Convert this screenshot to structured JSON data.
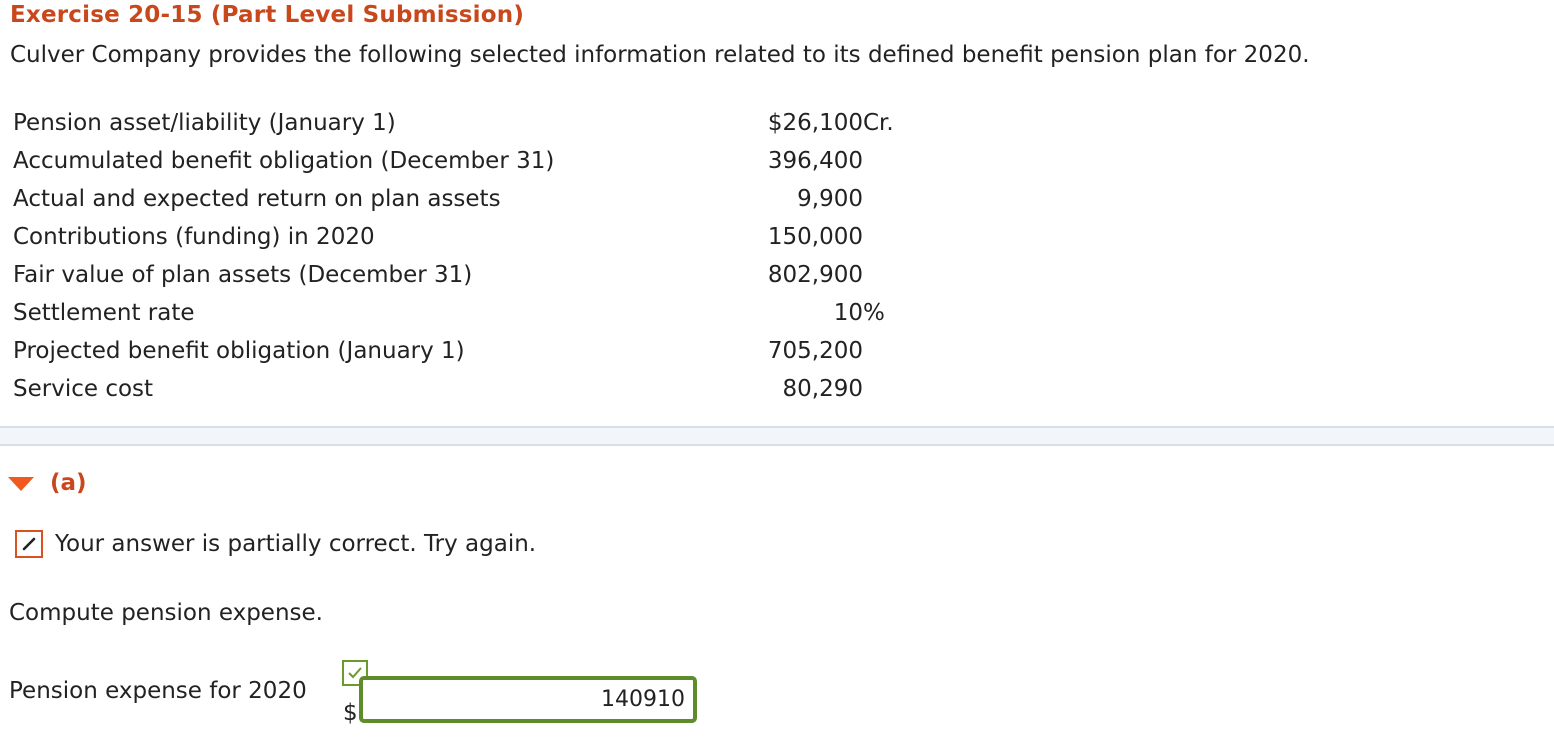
{
  "exercise": {
    "title": "Exercise 20-15 (Part Level Submission)",
    "intro": "Culver Company provides the following selected information related to its defined benefit pension plan for 2020."
  },
  "data_rows": [
    {
      "label": "Pension asset/liability (January 1)",
      "value": "$26,100",
      "suffix": " Cr."
    },
    {
      "label": "Accumulated benefit obligation (December 31)",
      "value": "396,400",
      "suffix": ""
    },
    {
      "label": "Actual and expected return on plan assets",
      "value": "9,900",
      "suffix": ""
    },
    {
      "label": "Contributions (funding) in 2020",
      "value": "150,000",
      "suffix": ""
    },
    {
      "label": "Fair value of plan assets (December 31)",
      "value": "802,900",
      "suffix": ""
    },
    {
      "label": "Settlement rate",
      "value": "10",
      "suffix": " %"
    },
    {
      "label": "Projected benefit obligation (January 1)",
      "value": "705,200",
      "suffix": ""
    },
    {
      "label": "Service cost",
      "value": "80,290",
      "suffix": ""
    }
  ],
  "part": {
    "label": "(a)",
    "toggle_icon": "caret-down-icon"
  },
  "feedback": {
    "icon": "pencil-icon",
    "text": "Your answer is partially correct.  Try again."
  },
  "question": {
    "text": "Compute pension expense."
  },
  "answer": {
    "label": "Pension expense for 2020",
    "currency": "$",
    "value": "140910",
    "status_icon": "checkmark-icon",
    "correct_color": "#5f8c2a"
  },
  "colors": {
    "accent": "#c8471b",
    "triangle": "#f05a1e",
    "correct": "#6a9a2c"
  }
}
